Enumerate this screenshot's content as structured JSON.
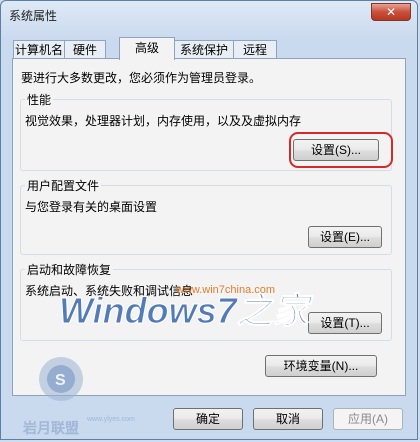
{
  "window": {
    "title": "系统属性",
    "close_glyph": "✕"
  },
  "tabs": [
    {
      "label": "计算机名"
    },
    {
      "label": "硬件"
    },
    {
      "label": "高级"
    },
    {
      "label": "系统保护"
    },
    {
      "label": "远程"
    }
  ],
  "admin_note": "要进行大多数更改，您必须作为管理员登录。",
  "performance": {
    "title": "性能",
    "description": "视觉效果，处理器计划，内存使用，以及及虚拟内存",
    "button": "设置(S)..."
  },
  "user_profiles": {
    "title": "用户配置文件",
    "description": "与您登录有关的桌面设置",
    "button": "设置(E)..."
  },
  "startup_recovery": {
    "title": "启动和故障恢复",
    "description": "系统启动、系统失败和调试信息",
    "button": "设置(T)..."
  },
  "env_button": "环境变量(N)...",
  "footer": {
    "ok": "确定",
    "cancel": "取消",
    "apply": "应用(A)"
  },
  "watermark": {
    "brand": "Windows7之家",
    "site": "www.win7china.com",
    "logo_text": "岩月联盟",
    "logo_url": "www.ylyes.com"
  }
}
